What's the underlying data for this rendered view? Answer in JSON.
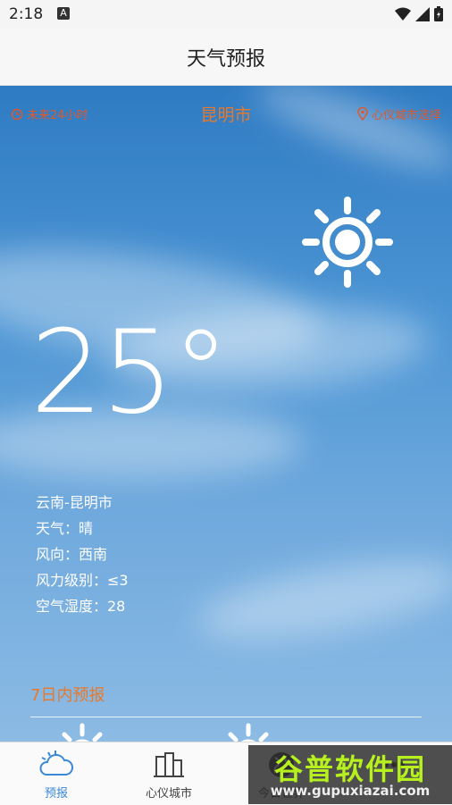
{
  "status_bar": {
    "time": "2:18",
    "a_label": "A"
  },
  "app_bar": {
    "title": "天气预报"
  },
  "top_links": {
    "left": "未来24小时",
    "city": "昆明市",
    "right": "心仪城市选择"
  },
  "weather": {
    "temperature": "25°",
    "location": "云南-昆明市",
    "condition": "天气：晴",
    "wind_direction": "风向：西南",
    "wind_level": "风力级别：≤3",
    "humidity": "空气湿度：28"
  },
  "forecast": {
    "title": "7日内预报"
  },
  "tabs": [
    {
      "label": "预报",
      "icon": "cloud-icon"
    },
    {
      "label": "心仪城市",
      "icon": "building-icon"
    },
    {
      "label": "今日世界",
      "icon": "globe-icon"
    },
    {
      "label": "",
      "icon": "more-icon"
    }
  ],
  "watermark": {
    "title": "谷普软件园",
    "url": "www.gupuxiazai.com"
  },
  "colors": {
    "accent": "#e8792a",
    "tab_active": "#3a88d8",
    "sky": "#3b86cc"
  }
}
